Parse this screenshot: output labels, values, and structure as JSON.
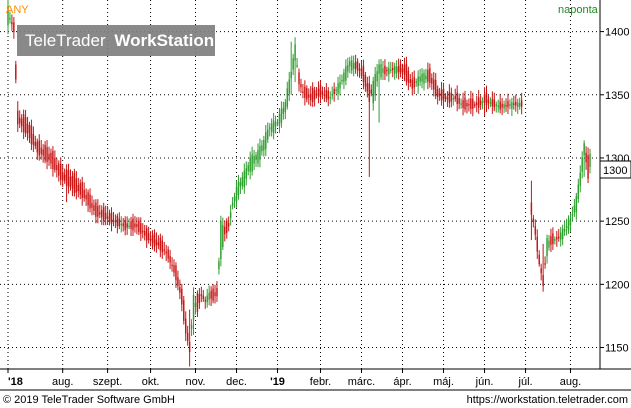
{
  "header": {
    "symbol": "ANY",
    "period": "naponta"
  },
  "logo": {
    "brand": "TeleTrader",
    "product": "WorkStation"
  },
  "footer": {
    "copyright": "© 2019 TeleTrader Software GmbH",
    "url": "https://workstation.teletrader.com"
  },
  "colors": {
    "up": "#2e9e2e",
    "down": "#c81414",
    "grid": "#000000",
    "symbol": "#ff8c00",
    "period": "#1a8c1a",
    "logo_bg": "#7f7f7f"
  },
  "chart_data": {
    "type": "candlestick",
    "title": "",
    "xlabel": "",
    "ylabel": "",
    "ylim": [
      1133,
      1425
    ],
    "y_ticks": [
      1150,
      1200,
      1250,
      1300,
      1350,
      1400
    ],
    "grid": true,
    "last_value_label": "1300",
    "x_ticks": [
      "'18",
      "aug.",
      "szept.",
      "okt.",
      "nov.",
      "dec.",
      "'19",
      "febr.",
      "márc.",
      "ápr.",
      "máj.",
      "jún.",
      "júl.",
      "aug."
    ],
    "x_tick_positions": [
      0,
      28,
      51,
      73,
      96,
      117,
      138,
      160,
      181,
      202,
      223,
      244,
      265,
      288
    ],
    "x_range": [
      0,
      298
    ],
    "ohlc_knots": [
      [
        0,
        1405,
        1420
      ],
      [
        3,
        1410,
        1398
      ],
      [
        5,
        1335,
        1328
      ],
      [
        10,
        1330,
        1318
      ],
      [
        15,
        1312,
        1305
      ],
      [
        22,
        1305,
        1295
      ],
      [
        28,
        1290,
        1282
      ],
      [
        33,
        1287,
        1275
      ],
      [
        38,
        1278,
        1270
      ],
      [
        45,
        1262,
        1255
      ],
      [
        52,
        1255,
        1250
      ],
      [
        60,
        1248,
        1245
      ],
      [
        66,
        1250,
        1244
      ],
      [
        72,
        1240,
        1235
      ],
      [
        78,
        1235,
        1228
      ],
      [
        82,
        1225,
        1222
      ],
      [
        86,
        1212,
        1205
      ],
      [
        89,
        1195,
        1185
      ],
      [
        91,
        1175,
        1160
      ],
      [
        93,
        1152,
        1148
      ],
      [
        95,
        1175,
        1190
      ],
      [
        97,
        1190,
        1180
      ],
      [
        99,
        1195,
        1190
      ],
      [
        101,
        1185,
        1188
      ],
      [
        103,
        1190,
        1192
      ],
      [
        105,
        1195,
        1188
      ],
      [
        107,
        1198,
        1190
      ],
      [
        109,
        1220,
        1250
      ],
      [
        111,
        1245,
        1240
      ],
      [
        113,
        1250,
        1245
      ],
      [
        115,
        1260,
        1266
      ],
      [
        118,
        1272,
        1280
      ],
      [
        121,
        1280,
        1288
      ],
      [
        124,
        1290,
        1300
      ],
      [
        128,
        1298,
        1305
      ],
      [
        131,
        1305,
        1315
      ],
      [
        134,
        1320,
        1326
      ],
      [
        138,
        1325,
        1330
      ],
      [
        142,
        1335,
        1345
      ],
      [
        145,
        1360,
        1370
      ],
      [
        147,
        1380,
        1388
      ],
      [
        149,
        1365,
        1360
      ],
      [
        151,
        1355,
        1350
      ],
      [
        155,
        1352,
        1345
      ],
      [
        160,
        1355,
        1350
      ],
      [
        165,
        1350,
        1347
      ],
      [
        170,
        1355,
        1360
      ],
      [
        175,
        1370,
        1378
      ],
      [
        179,
        1375,
        1370
      ],
      [
        182,
        1370,
        1362
      ],
      [
        185,
        1358,
        1345
      ],
      [
        187,
        1345,
        1360
      ],
      [
        190,
        1365,
        1375
      ],
      [
        193,
        1370,
        1368
      ],
      [
        198,
        1368,
        1372
      ],
      [
        203,
        1375,
        1365
      ],
      [
        207,
        1362,
        1355
      ],
      [
        212,
        1358,
        1368
      ],
      [
        216,
        1370,
        1360
      ],
      [
        220,
        1355,
        1348
      ],
      [
        225,
        1350,
        1345
      ],
      [
        229,
        1350,
        1346
      ],
      [
        233,
        1345,
        1340
      ],
      [
        238,
        1345,
        1340
      ],
      [
        242,
        1345,
        1342
      ],
      [
        244,
        1350,
        1344
      ],
      [
        248,
        1345,
        1342
      ],
      [
        252,
        1342,
        1340
      ],
      [
        256,
        1342,
        1342
      ],
      [
        260,
        1342,
        1343
      ],
      [
        263,
        1343,
        1342
      ],
      [
        268,
        1265,
        1255
      ],
      [
        270,
        1245,
        1240
      ],
      [
        272,
        1225,
        1215
      ],
      [
        274,
        1205,
        1200
      ],
      [
        276,
        1225,
        1235
      ],
      [
        279,
        1240,
        1232
      ],
      [
        282,
        1235,
        1238
      ],
      [
        285,
        1240,
        1245
      ],
      [
        288,
        1248,
        1252
      ],
      [
        291,
        1260,
        1268
      ],
      [
        293,
        1275,
        1290
      ],
      [
        295,
        1305,
        1310
      ],
      [
        297,
        1300,
        1285
      ],
      [
        298,
        1295,
        1302
      ]
    ],
    "wick_knots": [
      [
        0,
        1398,
        1425
      ],
      [
        5,
        1325,
        1345
      ],
      [
        30,
        1265,
        1295
      ],
      [
        51,
        1255,
        1262
      ],
      [
        93,
        1135,
        1180
      ],
      [
        95,
        1160,
        1195
      ],
      [
        145,
        1350,
        1392
      ],
      [
        147,
        1360,
        1392
      ],
      [
        185,
        1285,
        1362
      ],
      [
        190,
        1328,
        1378
      ],
      [
        244,
        1333,
        1352
      ],
      [
        268,
        1235,
        1282
      ],
      [
        274,
        1198,
        1232
      ],
      [
        295,
        1285,
        1312
      ]
    ]
  }
}
